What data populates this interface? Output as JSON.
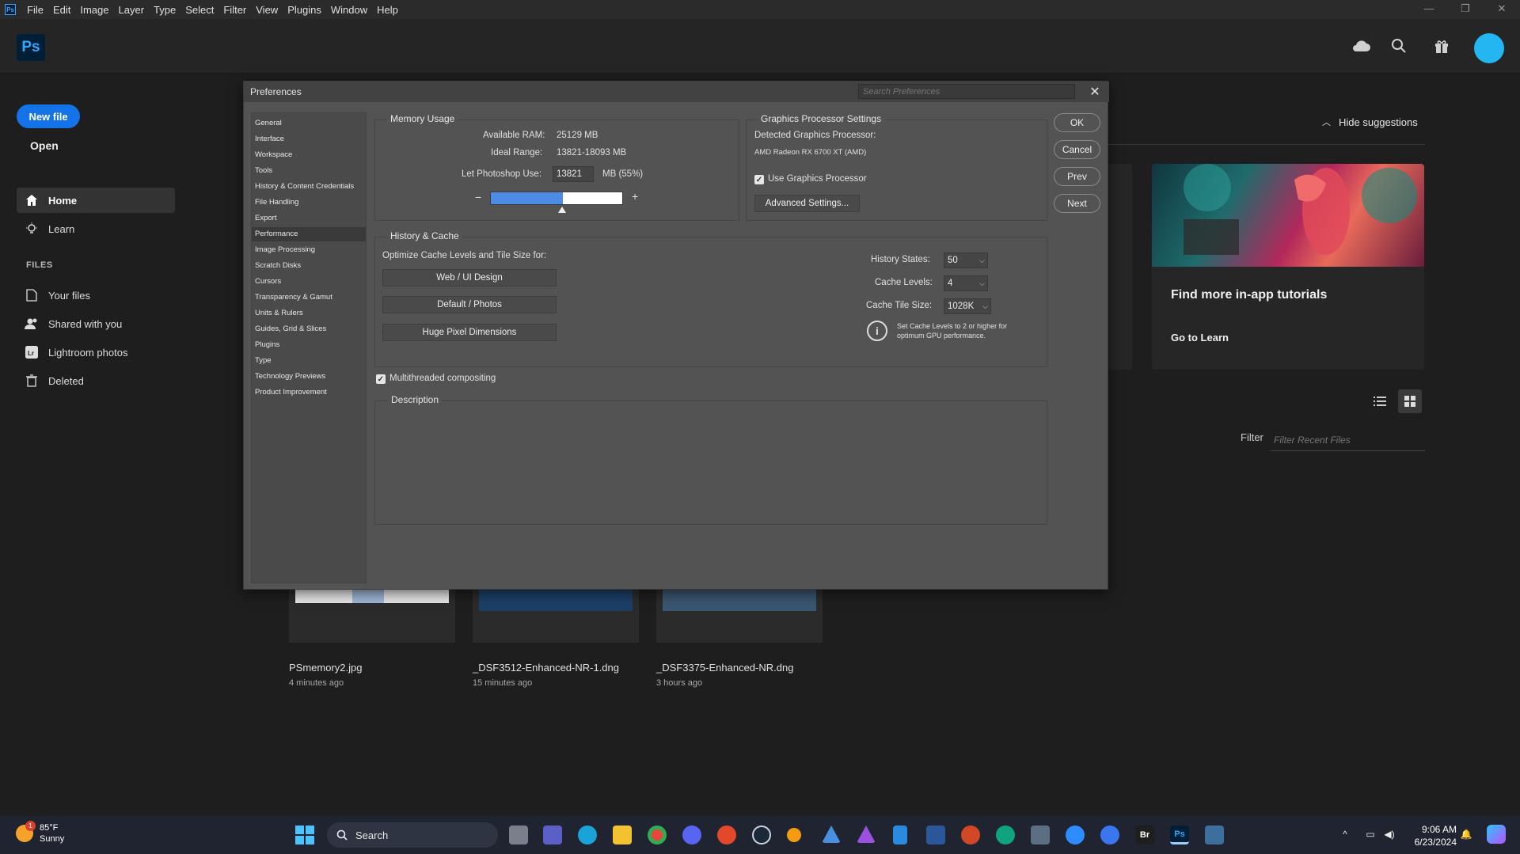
{
  "menubar": {
    "app_icon": "Ps",
    "items": [
      "File",
      "Edit",
      "Image",
      "Layer",
      "Type",
      "Select",
      "Filter",
      "View",
      "Plugins",
      "Window",
      "Help"
    ],
    "window_controls": [
      "minimize-icon",
      "restore-icon",
      "close-icon"
    ]
  },
  "header": {
    "logo": "Ps",
    "icons": [
      "cloud-icon",
      "search-icon",
      "gift-icon",
      "avatar"
    ],
    "avatar_color": "#24b6f0"
  },
  "sidebar": {
    "new_file": "New file",
    "open": "Open",
    "nav": [
      {
        "label": "Home",
        "icon": "home-icon"
      },
      {
        "label": "Learn",
        "icon": "lightbulb-icon"
      }
    ],
    "files_heading": "FILES",
    "files": [
      {
        "label": "Your files",
        "icon": "file-icon"
      },
      {
        "label": "Shared with you",
        "icon": "people-icon"
      },
      {
        "label": "Lightroom photos",
        "icon": "lightroom-icon"
      },
      {
        "label": "Deleted",
        "icon": "trash-icon"
      }
    ]
  },
  "main": {
    "hide_suggestions": "Hide suggestions",
    "tutorial_card": {
      "title": "Find more in-app tutorials",
      "link": "Go to Learn"
    },
    "filter_label": "Filter",
    "filter_placeholder": "Filter Recent Files",
    "recent_files": [
      {
        "name": "PSmemory2.jpg",
        "time": "4 minutes ago"
      },
      {
        "name": "_DSF3512-Enhanced-NR-1.dng",
        "time": "15 minutes ago"
      },
      {
        "name": "_DSF3375-Enhanced-NR.dng",
        "time": "3 hours ago"
      }
    ]
  },
  "dialog": {
    "title": "Preferences",
    "search_placeholder": "Search Preferences",
    "close": "✕",
    "nav": [
      "General",
      "Interface",
      "Workspace",
      "Tools",
      "History & Content Credentials",
      "File Handling",
      "Export",
      "Performance",
      "Image Processing",
      "Scratch Disks",
      "Cursors",
      "Transparency & Gamut",
      "Units & Rulers",
      "Guides, Grid & Slices",
      "Plugins",
      "Type",
      "Technology Previews",
      "Product Improvement"
    ],
    "selected_nav": "Performance",
    "memory": {
      "title": "Memory Usage",
      "available_label": "Available RAM:",
      "available_value": "25129 MB",
      "ideal_label": "Ideal Range:",
      "ideal_value": "13821-18093 MB",
      "let_label": "Let Photoshop Use:",
      "let_value": "13821",
      "let_unit": "MB (55%)",
      "usage_fraction": 0.55,
      "minus": "−",
      "plus": "+"
    },
    "gpu": {
      "title": "Graphics Processor Settings",
      "detected_label": "Detected Graphics Processor:",
      "detected_value": "AMD Radeon RX 6700 XT (AMD)",
      "use_gpu": "Use Graphics Processor",
      "use_gpu_checked": true,
      "advanced": "Advanced Settings..."
    },
    "history_cache": {
      "title": "History & Cache",
      "optimize_label": "Optimize Cache Levels and Tile Size for:",
      "buttons": [
        "Web / UI Design",
        "Default / Photos",
        "Huge Pixel Dimensions"
      ],
      "history_states_label": "History States:",
      "history_states_value": "50",
      "cache_levels_label": "Cache Levels:",
      "cache_levels_value": "4",
      "tile_size_label": "Cache Tile Size:",
      "tile_size_value": "1028K",
      "info": "Set Cache Levels to 2 or higher for optimum GPU performance."
    },
    "multithreaded": "Multithreaded compositing",
    "multithreaded_checked": true,
    "description_title": "Description",
    "buttons": {
      "ok": "OK",
      "cancel": "Cancel",
      "prev": "Prev",
      "next": "Next"
    }
  },
  "taskbar": {
    "weather_temp": "85°F",
    "weather_cond": "Sunny",
    "weather_badge": "1",
    "search": "Search",
    "time": "9:06 AM",
    "date": "6/23/2024",
    "icons": [
      "task-view-icon",
      "teams-icon",
      "edge-icon",
      "explorer-icon",
      "chrome-icon",
      "discord-icon",
      "ea-icon",
      "steam-icon",
      "perplexity-icon",
      "affinity-icon",
      "affinity-photo-icon",
      "notepad-icon",
      "word-icon",
      "powerpoint-icon",
      "chatgpt-icon",
      "app-icon",
      "zoom-icon",
      "signal-icon",
      "bridge-icon",
      "photoshop-icon",
      "photos-icon"
    ],
    "bridge_label": "Br",
    "ps_label": "Ps"
  }
}
